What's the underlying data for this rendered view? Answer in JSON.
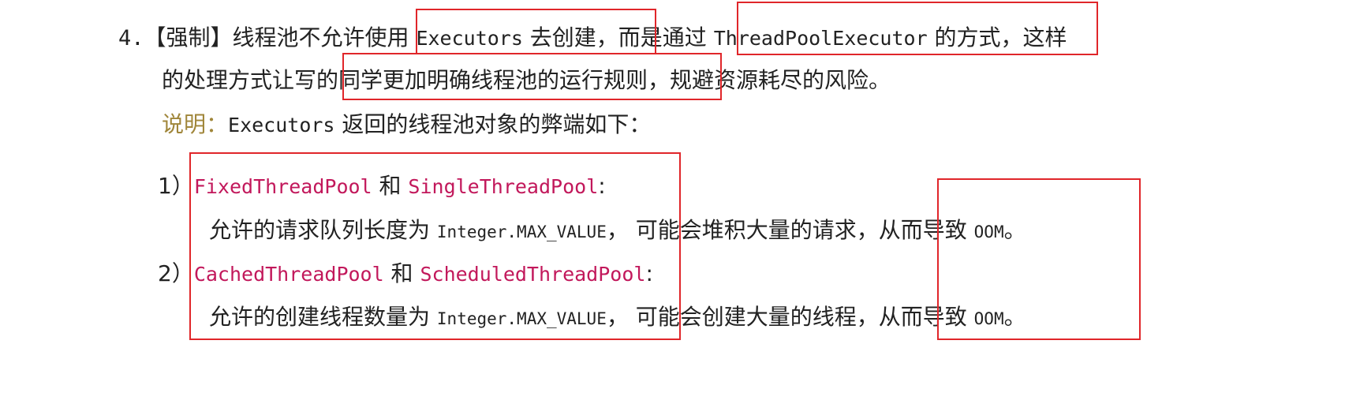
{
  "rule": {
    "number": "4.",
    "line1": {
      "tag": "【强制】",
      "text_a": "线程池不允许使用 ",
      "code_executors": "Executors",
      "text_b": " 去创建，而是通过 ",
      "code_tpe": "ThreadPoolExecutor",
      "text_c": " 的方式，这样"
    },
    "line2": {
      "text": "的处理方式让写的同学更加明确线程池的运行规则，规避资源耗尽的风险。"
    },
    "note": {
      "label": "说明：",
      "code": "Executors",
      "text": " 返回的线程池对象的弊端如下："
    }
  },
  "items": [
    {
      "marker": "1）",
      "pool_a": "FixedThreadPool",
      "conj": " 和 ",
      "pool_b": "SingleThreadPool",
      "colon": ":",
      "desc_a": "允许的请求队列长度为 ",
      "const": "Integer.MAX_VALUE",
      "desc_b": "， 可能会堆积大量的请求，从而导致 ",
      "oom": "OOM",
      "end": "。"
    },
    {
      "marker": "2）",
      "pool_a": "CachedThreadPool",
      "conj": " 和 ",
      "pool_b": "ScheduledThreadPool",
      "colon": ":",
      "desc_a": "允许的创建线程数量为 ",
      "const": "Integer.MAX_VALUE",
      "desc_b": "， 可能会创建大量的线程，从而导致 ",
      "oom": "OOM",
      "end": "。"
    }
  ],
  "highlight_color": "#e0262a",
  "code_color": "#c2185b",
  "note_color": "#a0863a"
}
